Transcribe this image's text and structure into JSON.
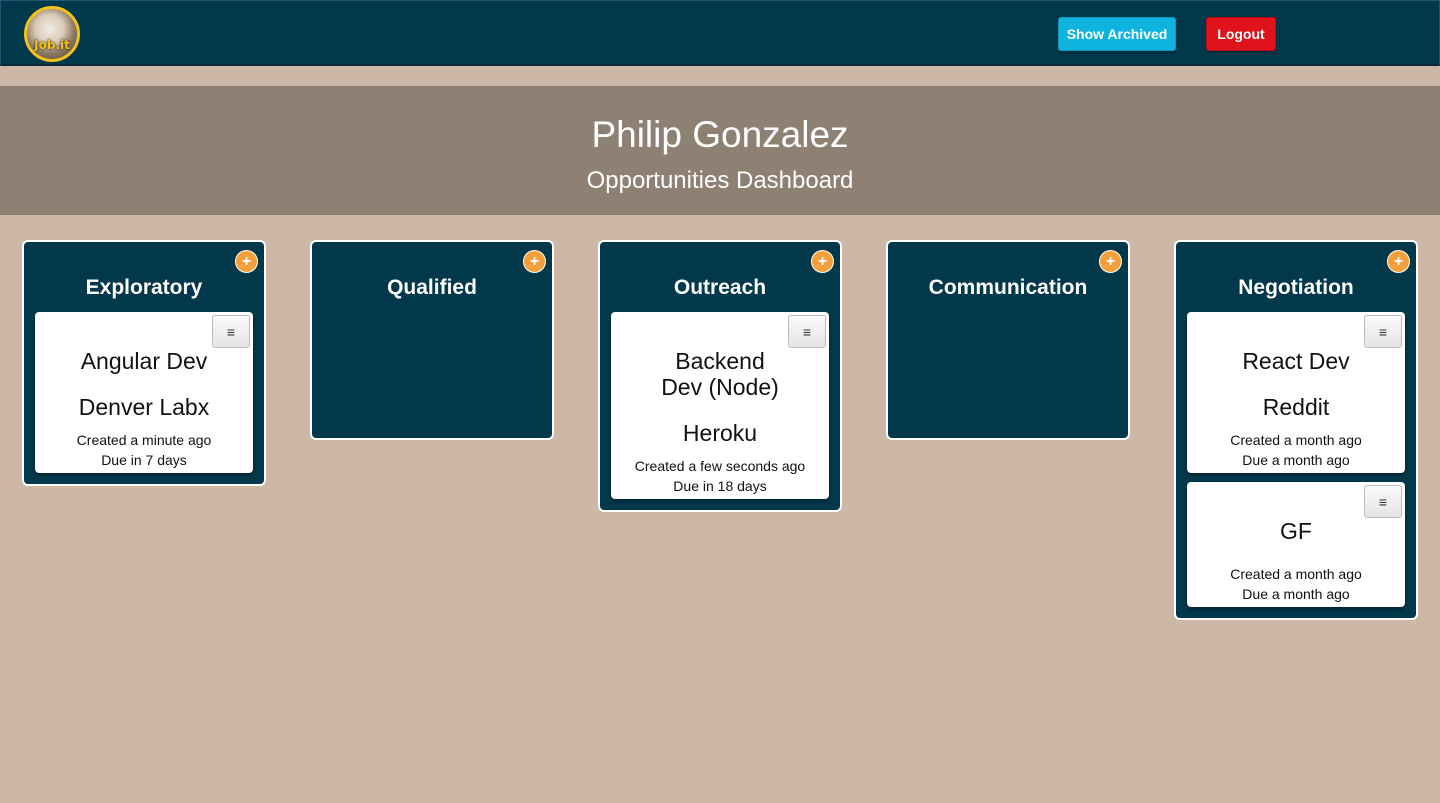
{
  "navbar": {
    "logo_text": "Job.it",
    "show_archived_label": "Show Archived",
    "logout_label": "Logout"
  },
  "banner": {
    "name": "Philip Gonzalez",
    "subtitle": "Opportunities Dashboard"
  },
  "add_glyph": "+",
  "menu_glyph": "≡",
  "columns": [
    {
      "title": "Exploratory",
      "cards": [
        {
          "title": "Angular Dev",
          "company": "Denver Labx",
          "created": "Created a minute ago",
          "due": "Due in 7 days"
        }
      ]
    },
    {
      "title": "Qualified",
      "cards": []
    },
    {
      "title": "Outreach",
      "cards": [
        {
          "title": "Backend Dev (Node)",
          "company": "Heroku",
          "created": "Created a few seconds ago",
          "due": "Due in 18 days"
        }
      ]
    },
    {
      "title": "Communication",
      "cards": []
    },
    {
      "title": "Negotiation",
      "cards": [
        {
          "title": "React Dev",
          "company": "Reddit",
          "created": "Created a month ago",
          "due": "Due a month ago"
        },
        {
          "title": "GF",
          "company": "",
          "created": "Created a month ago",
          "due": "Due a month ago"
        }
      ]
    }
  ],
  "colors": {
    "navbar": "#02384c",
    "page_background": "#cdb8a7",
    "banner": "#8f8074",
    "column": "#02384c",
    "add_button": "#f59f3b",
    "show_archived": "#0fb3e0",
    "logout": "#e0121c"
  }
}
